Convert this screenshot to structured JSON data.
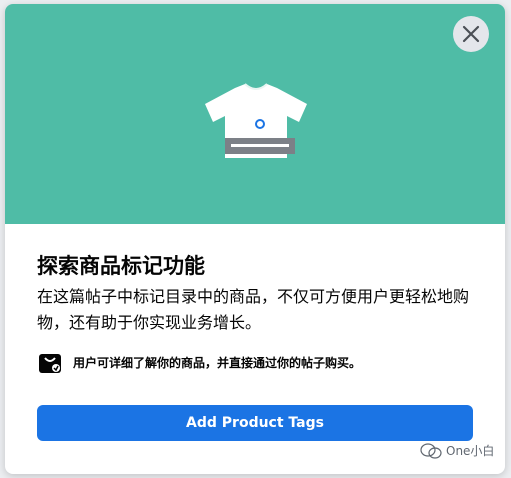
{
  "modal": {
    "close_icon": "close-icon",
    "hero_icon": "tshirt-tag-icon",
    "title": "探索商品标记功能",
    "description": "在这篇帖子中标记目录中的商品，不仅可方便用户更轻松地购物，还有助于你实现业务增长。",
    "feature": {
      "icon": "shopping-bag-icon",
      "text": "用户可详细了解你的商品，并直接通过你的帖子购买。"
    },
    "primary_button": "Add Product Tags"
  },
  "watermark": {
    "icon": "wechat-icon",
    "text": "One小白"
  },
  "colors": {
    "hero_bg": "#4fbca6",
    "button_bg": "#1b74e4",
    "button_text": "#ffffff"
  }
}
